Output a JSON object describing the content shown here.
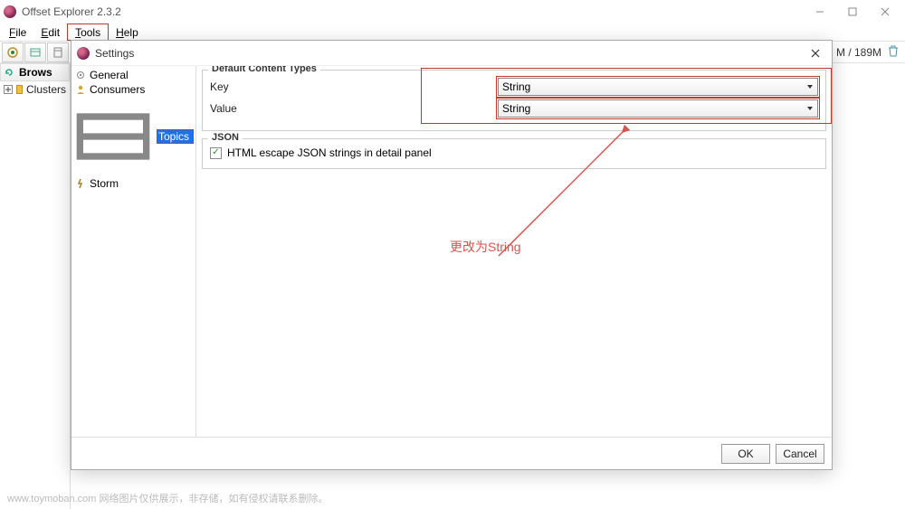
{
  "window": {
    "title": "Offset Explorer 2.3.2",
    "controls": {
      "min": "–",
      "max": "□",
      "close": "×"
    }
  },
  "menubar": {
    "file": "File",
    "edit": "Edit",
    "tools": "Tools",
    "help": "Help"
  },
  "toolbar": {
    "memory": "M / 189M"
  },
  "sidepanel": {
    "header": "Brows",
    "clusters": "Clusters"
  },
  "dialog": {
    "title": "Settings",
    "tree": {
      "general": "General",
      "consumers": "Consumers",
      "topics": "Topics",
      "storm": "Storm"
    },
    "content": {
      "group1_title": "Default Content Types",
      "key_label": "Key",
      "key_value": "String",
      "value_label": "Value",
      "value_value": "String",
      "group2_title": "JSON",
      "checkbox_label": "HTML escape JSON strings in detail panel"
    },
    "annotation": "更改为String",
    "footer": {
      "ok": "OK",
      "cancel": "Cancel"
    }
  },
  "watermark": "www.toymoban.com  网络图片仅供展示，非存储，如有侵权请联系删除。"
}
